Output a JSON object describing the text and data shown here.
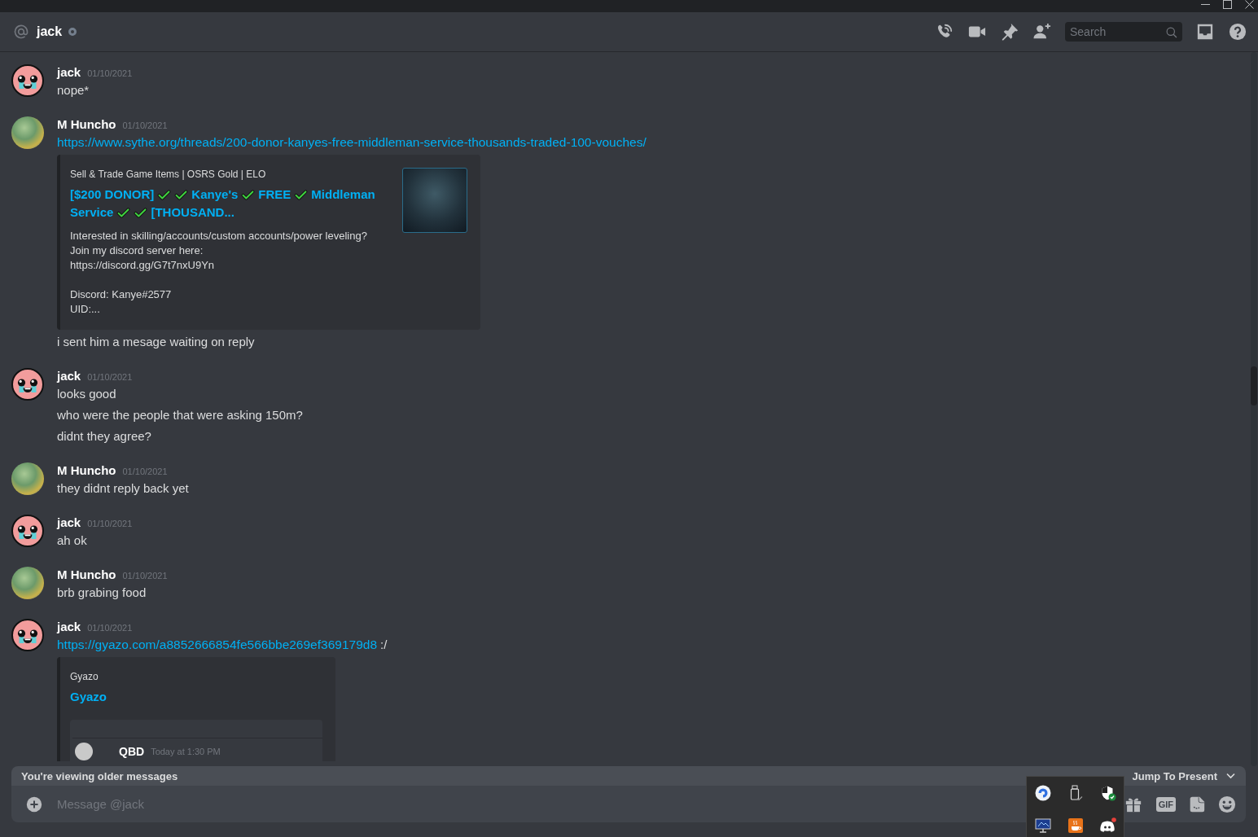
{
  "header": {
    "channel": "jack",
    "offline": true,
    "search": {
      "placeholder": "Search"
    }
  },
  "groups": [
    {
      "author": "jack",
      "timestamp": "01/10/2021",
      "avatar": {
        "kind": "cartoon"
      },
      "messages": [
        {
          "parts": [
            {
              "kind": "text",
              "text": "nope*"
            }
          ]
        }
      ]
    },
    {
      "author": "M Huncho",
      "timestamp": "01/10/2021",
      "avatar": {
        "kind": "photo"
      },
      "messages": [
        {
          "parts": [
            {
              "kind": "link",
              "text": "https://www.sythe.org/threads/200-donor-kanyes-free-middleman-service-thousands-traded-100-vouches/"
            }
          ],
          "embed": {
            "provider": "Sell & Trade Game Items | OSRS Gold | ELO",
            "title": [
              {
                "kind": "text",
                "text": "[$200 DONOR]"
              },
              {
                "kind": "check"
              },
              {
                "kind": "check"
              },
              {
                "kind": "text",
                "text": "Kanye's"
              },
              {
                "kind": "check"
              },
              {
                "kind": "text",
                "text": "FREE"
              },
              {
                "kind": "check"
              },
              {
                "kind": "text",
                "text": "Middleman"
              },
              {
                "kind": "text",
                "text": "Service"
              },
              {
                "kind": "check"
              },
              {
                "kind": "check"
              },
              {
                "kind": "text",
                "text": "[THOUSAND..."
              }
            ],
            "description": [
              "Interested in skilling/accounts/custom accounts/power leveling?\nJoin my discord server here:\nhttps://discord.gg/G7t7nxU9Yn",
              "Discord: Kanye#2577\nUID:..."
            ],
            "thumbnail": true
          }
        },
        {
          "parts": [
            {
              "kind": "text",
              "text": "i sent him a mesage waiting on reply"
            }
          ]
        }
      ]
    },
    {
      "author": "jack",
      "timestamp": "01/10/2021",
      "avatar": {
        "kind": "cartoon"
      },
      "messages": [
        {
          "parts": [
            {
              "kind": "text",
              "text": "looks good"
            }
          ]
        },
        {
          "parts": [
            {
              "kind": "text",
              "text": "who were the people that were asking 150m?"
            }
          ]
        },
        {
          "parts": [
            {
              "kind": "text",
              "text": "didnt they agree?"
            }
          ]
        }
      ]
    },
    {
      "author": "M Huncho",
      "timestamp": "01/10/2021",
      "avatar": {
        "kind": "photo"
      },
      "messages": [
        {
          "parts": [
            {
              "kind": "text",
              "text": "they didnt reply back yet"
            }
          ]
        }
      ]
    },
    {
      "author": "jack",
      "timestamp": "01/10/2021",
      "avatar": {
        "kind": "cartoon"
      },
      "messages": [
        {
          "parts": [
            {
              "kind": "text",
              "text": "ah ok"
            }
          ]
        }
      ]
    },
    {
      "author": "M Huncho",
      "timestamp": "01/10/2021",
      "avatar": {
        "kind": "photo"
      },
      "messages": [
        {
          "parts": [
            {
              "kind": "text",
              "text": "brb grabing food"
            }
          ]
        }
      ]
    },
    {
      "author": "jack",
      "timestamp": "01/10/2021",
      "avatar": {
        "kind": "cartoon"
      },
      "messages": [
        {
          "parts": [
            {
              "kind": "link",
              "text": "https://gyazo.com/a8852666854fe566bbe269ef369179d8"
            },
            {
              "kind": "text",
              "text": ":/"
            }
          ],
          "embed": {
            "provider": "Gyazo",
            "title": [
              {
                "kind": "text",
                "text": "Gyazo"
              }
            ],
            "preview": {
              "author": "QBD",
              "timestamp": "Today at 1:30 PM"
            }
          }
        }
      ]
    }
  ],
  "older_messages_bar": {
    "notice": "You're viewing older messages",
    "action": "Jump To Present"
  },
  "composer": {
    "placeholder": "Message @jack",
    "gif_button": "GIF"
  },
  "tray": {
    "expanded": true
  }
}
